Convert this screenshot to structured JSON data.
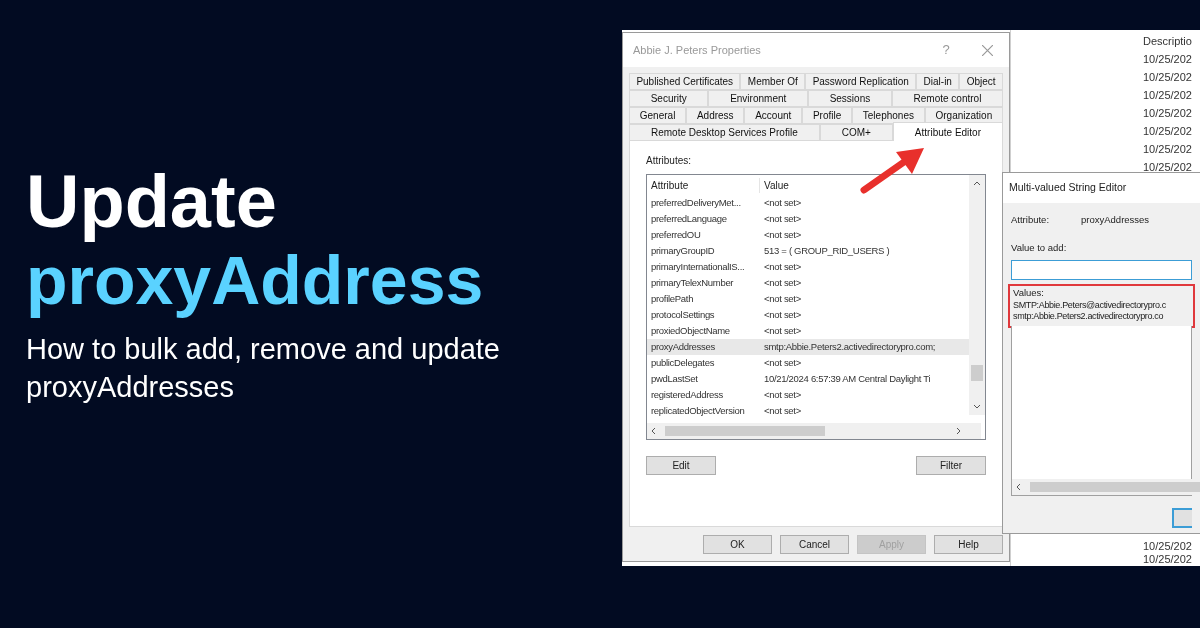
{
  "headline": {
    "line_1": "Update",
    "line_2": "proxyAddress",
    "subtitle": "How to bulk add, remove and update proxyAddresses"
  },
  "screenshot": {
    "background_list": {
      "column_header": "Descriptio",
      "dates_top": [
        "10/25/202",
        "10/25/202",
        "10/25/202",
        "10/25/202",
        "10/25/202",
        "10/25/202",
        "10/25/202"
      ],
      "dates_bottom": [
        "10/25/202",
        "10/25/202"
      ]
    },
    "properties_dialog": {
      "title": "Abbie J. Peters Properties",
      "help": "?",
      "tab_rows": [
        [
          {
            "label": "Published Certificates",
            "selected": false
          },
          {
            "label": "Member Of",
            "selected": false
          },
          {
            "label": "Password Replication",
            "selected": false
          },
          {
            "label": "Dial-in",
            "selected": false
          },
          {
            "label": "Object",
            "selected": false
          }
        ],
        [
          {
            "label": "Security",
            "selected": false
          },
          {
            "label": "Environment",
            "selected": false
          },
          {
            "label": "Sessions",
            "selected": false
          },
          {
            "label": "Remote control",
            "selected": false
          }
        ],
        [
          {
            "label": "General",
            "selected": false
          },
          {
            "label": "Address",
            "selected": false
          },
          {
            "label": "Account",
            "selected": false
          },
          {
            "label": "Profile",
            "selected": false
          },
          {
            "label": "Telephones",
            "selected": false
          },
          {
            "label": "Organization",
            "selected": false
          }
        ],
        [
          {
            "label": "Remote Desktop Services Profile",
            "selected": false
          },
          {
            "label": "COM+",
            "selected": false
          },
          {
            "label": "Attribute Editor",
            "selected": true
          }
        ]
      ],
      "attributes_label": "Attributes:",
      "columns": [
        "Attribute",
        "Value"
      ],
      "rows": [
        {
          "attribute": "preferredDeliveryMet...",
          "value": "<not set>",
          "selected": false
        },
        {
          "attribute": "preferredLanguage",
          "value": "<not set>",
          "selected": false
        },
        {
          "attribute": "preferredOU",
          "value": "<not set>",
          "selected": false
        },
        {
          "attribute": "primaryGroupID",
          "value": "513 = ( GROUP_RID_USERS )",
          "selected": false
        },
        {
          "attribute": "primaryInternationalIS...",
          "value": "<not set>",
          "selected": false
        },
        {
          "attribute": "primaryTelexNumber",
          "value": "<not set>",
          "selected": false
        },
        {
          "attribute": "profilePath",
          "value": "<not set>",
          "selected": false
        },
        {
          "attribute": "protocolSettings",
          "value": "<not set>",
          "selected": false
        },
        {
          "attribute": "proxiedObjectName",
          "value": "<not set>",
          "selected": false
        },
        {
          "attribute": "proxyAddresses",
          "value": "smtp:Abbie.Peters2.activedirectorypro.com;",
          "selected": true
        },
        {
          "attribute": "publicDelegates",
          "value": "<not set>",
          "selected": false
        },
        {
          "attribute": "pwdLastSet",
          "value": "10/21/2024 6:57:39 AM Central Daylight Ti",
          "selected": false
        },
        {
          "attribute": "registeredAddress",
          "value": "<not set>",
          "selected": false
        },
        {
          "attribute": "replicatedObjectVersion",
          "value": "<not set>",
          "selected": false
        }
      ],
      "list_buttons": [
        {
          "label": "Edit",
          "disabled": false
        },
        {
          "label": "Filter",
          "disabled": false
        }
      ],
      "footer_buttons": [
        {
          "label": "OK",
          "disabled": false
        },
        {
          "label": "Cancel",
          "disabled": false
        },
        {
          "label": "Apply",
          "disabled": true
        },
        {
          "label": "Help",
          "disabled": false
        }
      ]
    },
    "string_editor": {
      "title": "Multi-valued String Editor",
      "attribute_label": "Attribute:",
      "attribute_value": "proxyAddresses",
      "value_to_add_label": "Value to add:",
      "value_input": {
        "focused": true
      },
      "values_label": "Values:",
      "values_highlighted": true,
      "values": [
        "SMTP:Abbie.Peters@activedirectorypro.c",
        "smtp:Abbie.Peters2.activedirectorypro.co"
      ]
    }
  }
}
